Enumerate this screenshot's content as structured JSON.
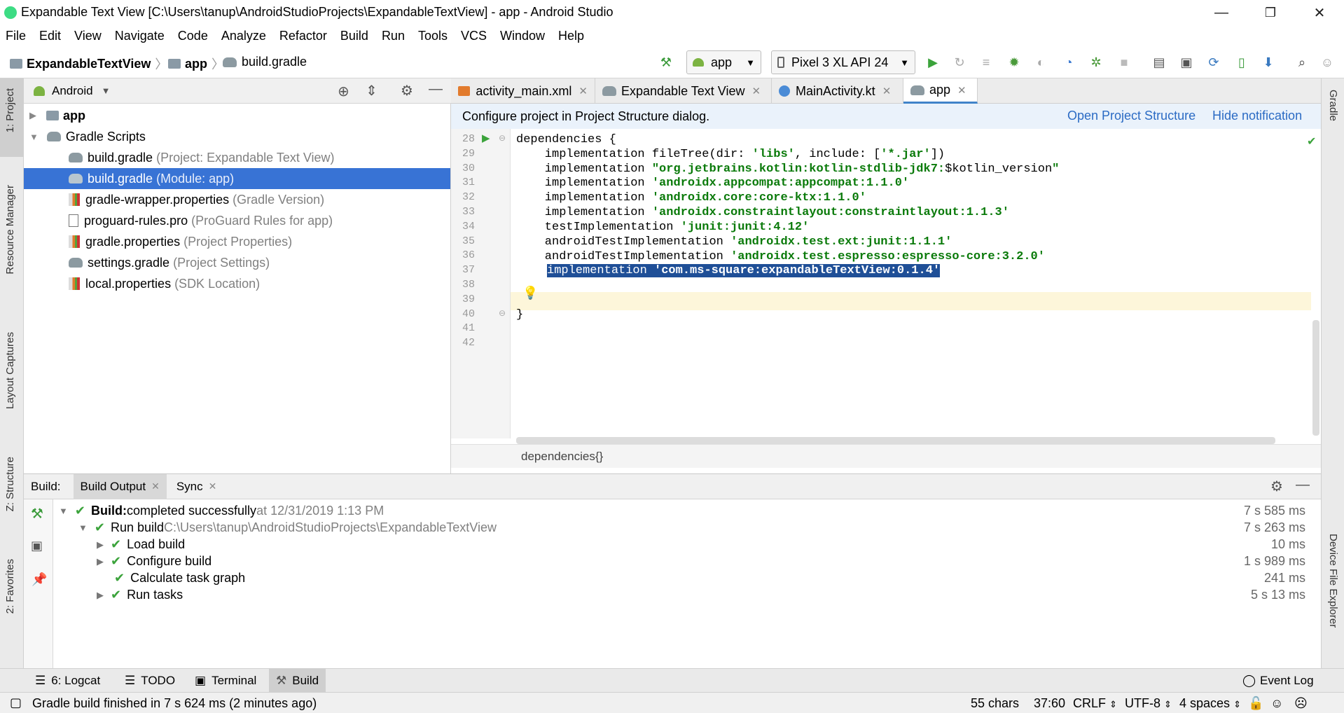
{
  "window": {
    "title": "Expandable Text View [C:\\Users\\tanup\\AndroidStudioProjects\\ExpandableTextView] - app - Android Studio",
    "minimize": "—",
    "maximize": "❐",
    "close": "✕"
  },
  "menu": [
    "File",
    "Edit",
    "View",
    "Navigate",
    "Code",
    "Analyze",
    "Refactor",
    "Build",
    "Run",
    "Tools",
    "VCS",
    "Window",
    "Help"
  ],
  "nav": {
    "crumbs": [
      "ExpandableTextView",
      "app",
      "build.gradle"
    ],
    "config": "app",
    "device": "Pixel 3 XL API 24"
  },
  "left_stripe": [
    "1: Project",
    "Resource Manager",
    "Layout Captures",
    "Z: Structure",
    "2: Favorites"
  ],
  "right_stripe": [
    "Gradle",
    "Device File Explorer"
  ],
  "project": {
    "view_mode": "Android",
    "items": [
      {
        "label": "app",
        "extra": ""
      },
      {
        "label": "Gradle Scripts",
        "extra": ""
      },
      {
        "label": "build.gradle",
        "extra": "(Project: Expandable Text View)"
      },
      {
        "label": "build.gradle",
        "extra": "(Module: app)"
      },
      {
        "label": "gradle-wrapper.properties",
        "extra": "(Gradle Version)"
      },
      {
        "label": "proguard-rules.pro",
        "extra": "(ProGuard Rules for app)"
      },
      {
        "label": "gradle.properties",
        "extra": "(Project Properties)"
      },
      {
        "label": "settings.gradle",
        "extra": "(Project Settings)"
      },
      {
        "label": "local.properties",
        "extra": "(SDK Location)"
      }
    ]
  },
  "editor": {
    "tabs": [
      "activity_main.xml",
      "Expandable Text View",
      "MainActivity.kt",
      "app"
    ],
    "notification": "Configure project in Project Structure dialog.",
    "open_structure": "Open Project Structure",
    "hide_notification": "Hide notification",
    "line_numbers": [
      "28",
      "29",
      "30",
      "31",
      "32",
      "33",
      "34",
      "35",
      "36",
      "37",
      "38",
      "39",
      "40",
      "41",
      "42"
    ],
    "code": {
      "l28": "dependencies {",
      "l29_a": "    implementation fileTree(dir: ",
      "l29_b": "'libs'",
      "l29_c": ", include: [",
      "l29_d": "'*.jar'",
      "l29_e": "])",
      "l30_a": "    implementation ",
      "l30_b": "\"org.jetbrains.kotlin:kotlin-stdlib-jdk7:",
      "l30_c": "$kotlin_version",
      "l30_d": "\"",
      "l31_a": "    implementation ",
      "l31_b": "'androidx.appcompat:appcompat:1.1.0'",
      "l32_a": "    implementation ",
      "l32_b": "'androidx.core:core-ktx:1.1.0'",
      "l33_a": "    implementation ",
      "l33_b": "'androidx.constraintlayout:constraintlayout:1.1.3'",
      "l34_a": "    testImplementation ",
      "l34_b": "'junit:junit:4.12'",
      "l35_a": "    androidTestImplementation ",
      "l35_b": "'androidx.test.ext:junit:1.1.1'",
      "l36_a": "    androidTestImplementation ",
      "l36_b": "'androidx.test.espresso:espresso-core:3.2.0'",
      "l37_a": "implementation ",
      "l37_b": "'com.ms-square:expandableTextView:0.1.4'",
      "l40": "}"
    },
    "breadcrumb": "dependencies{}"
  },
  "build": {
    "label": "Build:",
    "tabs": [
      "Build Output",
      "Sync"
    ],
    "rows": [
      {
        "bold": "Build:",
        "text": " completed successfully",
        "muted": " at 12/31/2019 1:13 PM",
        "time": "7 s 585 ms"
      },
      {
        "bold": "",
        "text": "Run build",
        "muted": " C:\\Users\\tanup\\AndroidStudioProjects\\ExpandableTextView",
        "time": "7 s 263 ms"
      },
      {
        "bold": "",
        "text": "Load build",
        "muted": "",
        "time": "10 ms"
      },
      {
        "bold": "",
        "text": "Configure build",
        "muted": "",
        "time": "1 s 989 ms"
      },
      {
        "bold": "",
        "text": "Calculate task graph",
        "muted": "",
        "time": "241 ms"
      },
      {
        "bold": "",
        "text": "Run tasks",
        "muted": "",
        "time": "5 s 13 ms"
      }
    ]
  },
  "bottom_tools": [
    "6: Logcat",
    "TODO",
    "Terminal",
    "Build",
    "Event Log"
  ],
  "status": {
    "message": "Gradle build finished in 7 s 624 ms (2 minutes ago)",
    "chars": "55 chars",
    "position": "37:60",
    "line_sep": "CRLF",
    "encoding": "UTF-8",
    "indent": "4 spaces"
  }
}
